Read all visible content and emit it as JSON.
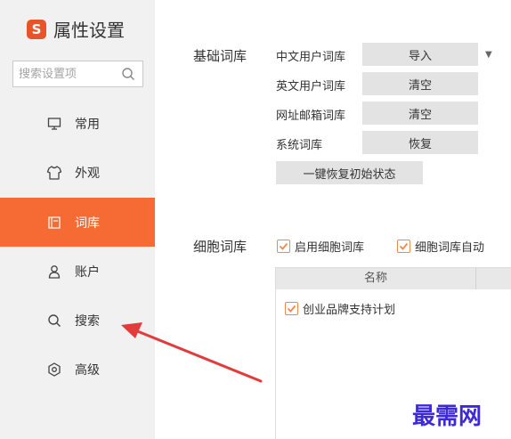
{
  "app": {
    "title": "属性设置",
    "logo_char": "S"
  },
  "search": {
    "placeholder": "搜索设置项"
  },
  "sidebar": {
    "items": [
      {
        "label": "常用",
        "icon": "monitor-icon"
      },
      {
        "label": "外观",
        "icon": "shirt-icon"
      },
      {
        "label": "词库",
        "icon": "book-icon",
        "active": true
      },
      {
        "label": "账户",
        "icon": "user-icon"
      },
      {
        "label": "搜索",
        "icon": "search-icon"
      },
      {
        "label": "高级",
        "icon": "gear-icon"
      }
    ]
  },
  "basic": {
    "label": "基础词库",
    "rows": [
      {
        "label": "中文用户词库",
        "button": "导入"
      },
      {
        "label": "英文用户词库",
        "button": "清空"
      },
      {
        "label": "网址邮箱词库",
        "button": "清空"
      },
      {
        "label": "系统词库",
        "button": "恢复"
      }
    ],
    "reset_button": "一键恢复初始状态"
  },
  "cell": {
    "label": "细胞词库",
    "enable_checkbox": "启用细胞词库",
    "auto_checkbox": "细胞词库自动",
    "table_header": "名称",
    "rows": [
      "创业品牌支持计划"
    ]
  },
  "watermark": "最需网",
  "colors": {
    "accent": "#f66b34",
    "watermark": "#3d2ad6",
    "arrow": "#e23b3b"
  }
}
